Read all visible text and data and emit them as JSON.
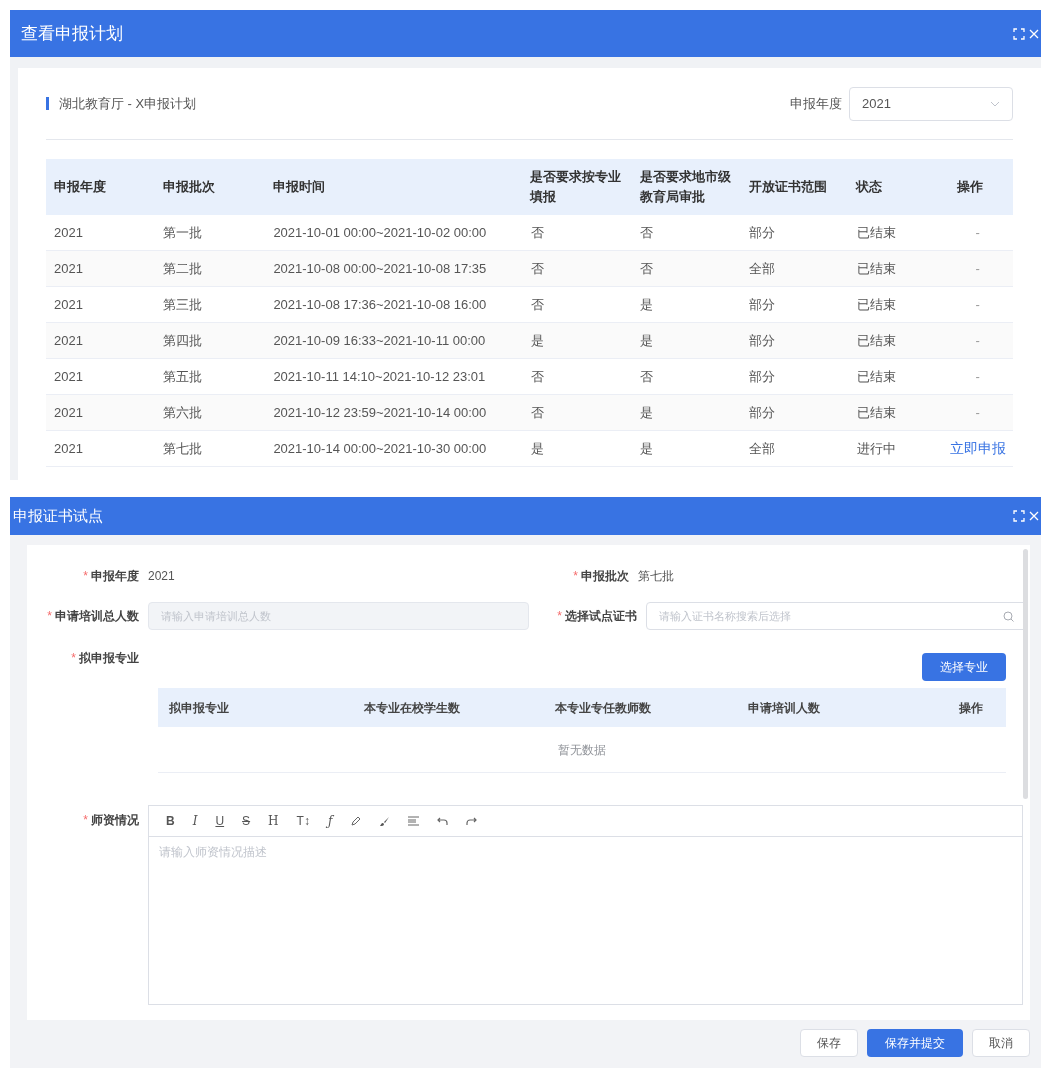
{
  "plan_dialog": {
    "title": "查看申报计划",
    "section_title": "湖北教育厅 - X申报计划",
    "year_filter": {
      "label": "申报年度",
      "value": "2021"
    },
    "table": {
      "columns": [
        "申报年度",
        "申报批次",
        "申报时间",
        "是否要求按专业填报",
        "是否要求地市级教育局审批",
        "开放证书范围",
        "状态",
        "操作"
      ],
      "rows": [
        {
          "cells": [
            "2021",
            "第一批",
            "2021-10-01 00:00~2021-10-02 00:00",
            "否",
            "否",
            "部分",
            "已结束"
          ],
          "action": {
            "kind": "dash",
            "text": "-"
          }
        },
        {
          "cells": [
            "2021",
            "第二批",
            "2021-10-08 00:00~2021-10-08 17:35",
            "否",
            "否",
            "全部",
            "已结束"
          ],
          "action": {
            "kind": "dash",
            "text": "-"
          }
        },
        {
          "cells": [
            "2021",
            "第三批",
            "2021-10-08 17:36~2021-10-08 16:00",
            "否",
            "是",
            "部分",
            "已结束"
          ],
          "action": {
            "kind": "dash",
            "text": "-"
          }
        },
        {
          "cells": [
            "2021",
            "第四批",
            "2021-10-09 16:33~2021-10-11 00:00",
            "是",
            "是",
            "部分",
            "已结束"
          ],
          "action": {
            "kind": "dash",
            "text": "-"
          }
        },
        {
          "cells": [
            "2021",
            "第五批",
            "2021-10-11 14:10~2021-10-12 23:01",
            "否",
            "否",
            "部分",
            "已结束"
          ],
          "action": {
            "kind": "dash",
            "text": "-"
          }
        },
        {
          "cells": [
            "2021",
            "第六批",
            "2021-10-12 23:59~2021-10-14 00:00",
            "否",
            "是",
            "部分",
            "已结束"
          ],
          "action": {
            "kind": "dash",
            "text": "-"
          }
        },
        {
          "cells": [
            "2021",
            "第七批",
            "2021-10-14 00:00~2021-10-30 00:00",
            "是",
            "是",
            "全部",
            "进行中"
          ],
          "action": {
            "kind": "link",
            "text": "立即申报"
          }
        }
      ]
    }
  },
  "apply_dialog": {
    "title": "申报证书试点",
    "year": {
      "mark": "*",
      "label": "申报年度",
      "value": "2021"
    },
    "batch": {
      "mark": "*",
      "label": "申报批次",
      "value": "第七批"
    },
    "total_trainees": {
      "mark": "*",
      "label": "申请培训总人数",
      "placeholder": "请输入申请培训总人数",
      "disabled": true
    },
    "certificate": {
      "mark": "*",
      "label": "选择试点证书",
      "placeholder": "请输入证书名称搜索后选择"
    },
    "majors": {
      "mark": "*",
      "label": "拟申报专业",
      "button": "选择专业",
      "columns": [
        "拟申报专业",
        "本专业在校学生数",
        "本专业专任教师数",
        "申请培训人数",
        "操作"
      ],
      "empty_text": "暂无数据"
    },
    "teachers": {
      "mark": "*",
      "label": "师资情况",
      "toolbar": [
        "B",
        "I",
        "U",
        "S",
        "H",
        "T↕",
        "ƒ"
      ],
      "placeholder": "请输入师资情况描述"
    },
    "buttons": [
      {
        "label": "保存",
        "primary": false
      },
      {
        "label": "保存并提交",
        "primary": true
      },
      {
        "label": "取消",
        "primary": false
      }
    ]
  }
}
